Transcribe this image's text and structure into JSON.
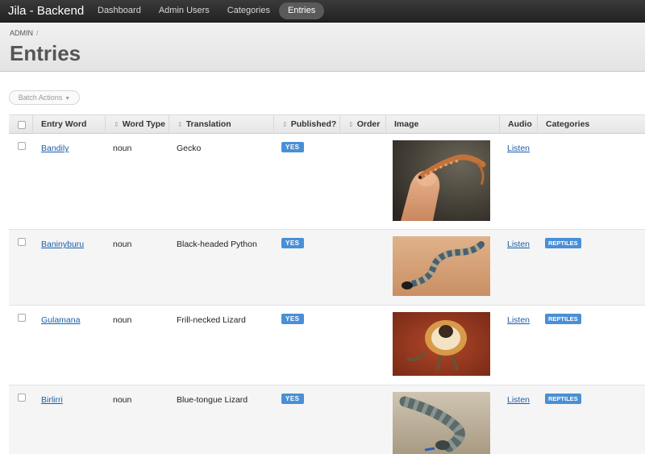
{
  "app": {
    "brand": "Jila - Backend"
  },
  "nav": [
    "Dashboard",
    "Admin Users",
    "Categories",
    "Entries"
  ],
  "nav_active": "Entries",
  "breadcrumb": {
    "items": [
      "ADMIN"
    ],
    "separator": "/"
  },
  "page_title": "Entries",
  "batch_actions_label": "Batch Actions",
  "table": {
    "columns": [
      "Entry Word",
      "Word Type",
      "Translation",
      "Published?",
      "Order",
      "Image",
      "Audio",
      "Categories"
    ],
    "rows": [
      {
        "entry_word": "Bandily",
        "word_type": "noun",
        "translation": "Gecko",
        "published": "YES",
        "order": "",
        "image": "gecko-on-finger-photo",
        "audio": "Listen",
        "category": ""
      },
      {
        "entry_word": "Baninyburu",
        "word_type": "noun",
        "translation": "Black-headed Python",
        "published": "YES",
        "order": "",
        "image": "black-headed-python-photo",
        "audio": "Listen",
        "category": "REPTILES"
      },
      {
        "entry_word": "Gulamana",
        "word_type": "noun",
        "translation": "Frill-necked Lizard",
        "published": "YES",
        "order": "",
        "image": "frill-necked-lizard-photo",
        "audio": "Listen",
        "category": "REPTILES"
      },
      {
        "entry_word": "Birlirri",
        "word_type": "noun",
        "translation": "Blue-tongue Lizard",
        "published": "YES",
        "order": "",
        "image": "blue-tongue-lizard-photo",
        "audio": "Listen",
        "category": "REPTILES"
      }
    ]
  },
  "colors": {
    "topbar": "#2b2b2b",
    "accent": "#4a8fd6",
    "link": "#1a5ea8"
  }
}
